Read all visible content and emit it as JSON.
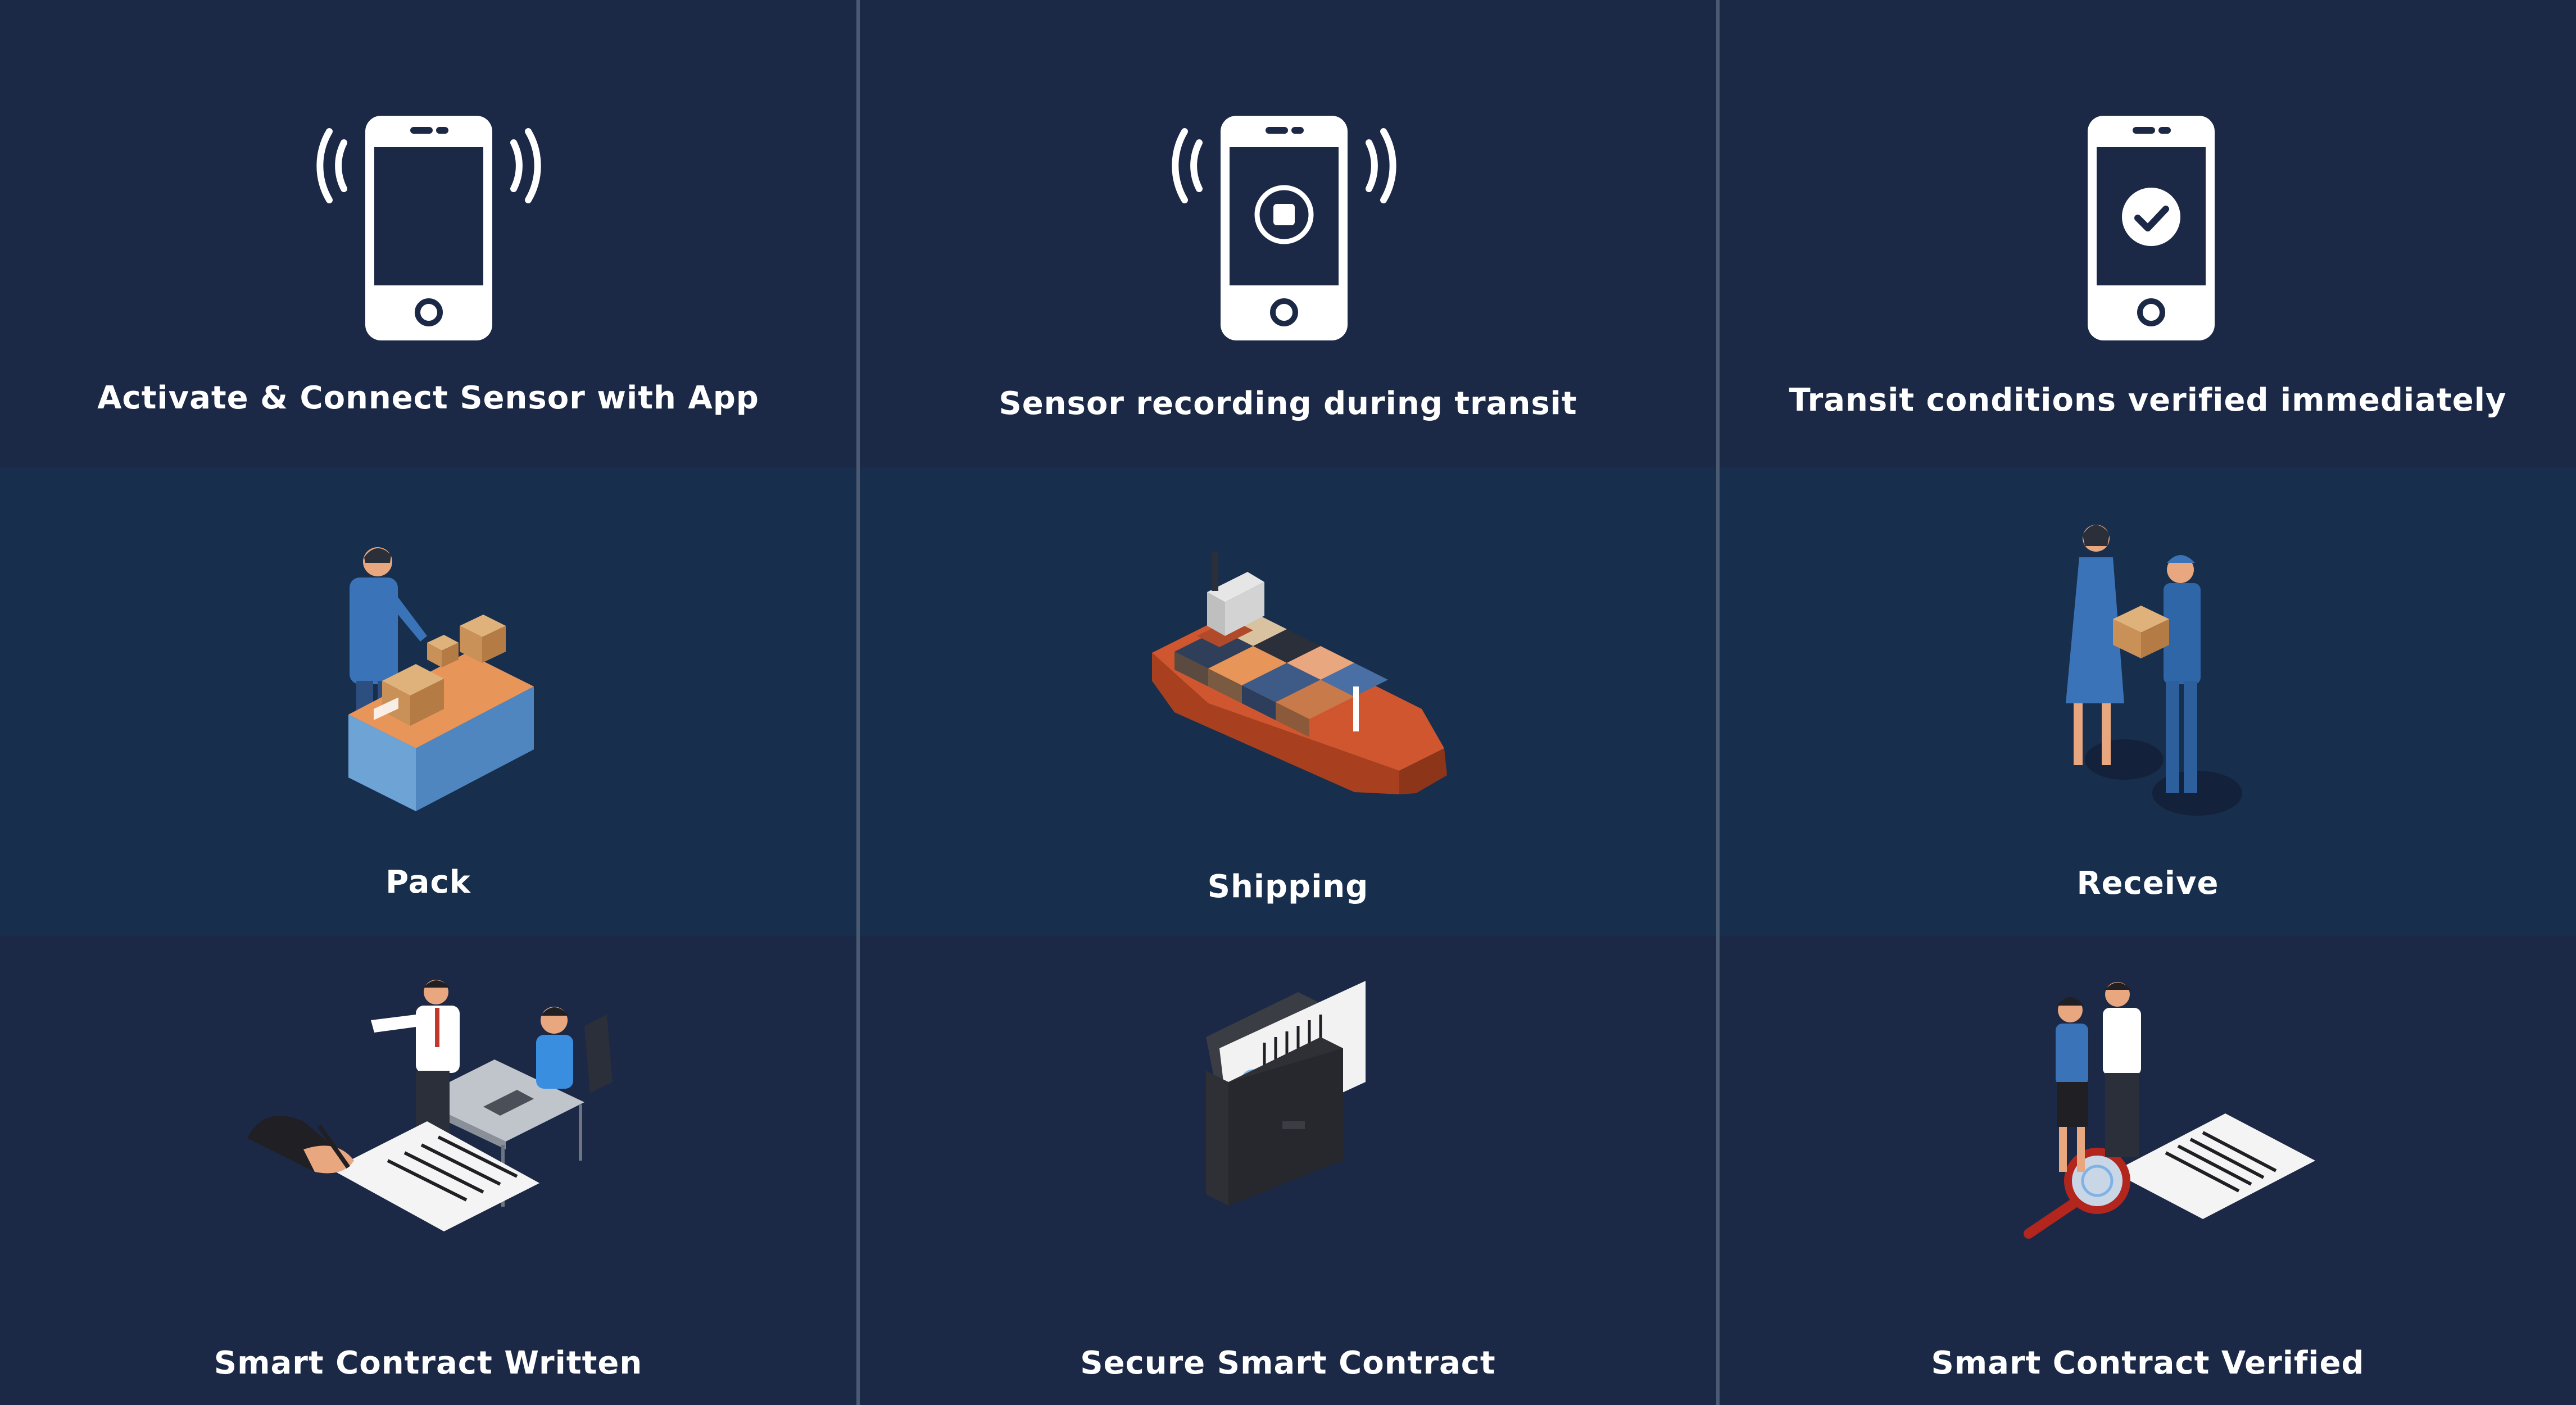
{
  "steps": [
    {
      "label": "Activate & Connect Sensor with App",
      "icon": "phone-signal-icon"
    },
    {
      "label": "Sensor recording during transit",
      "icon": "phone-recording-icon"
    },
    {
      "label": "Transit conditions verified immediately",
      "icon": "phone-check-icon"
    },
    {
      "label": "Pack",
      "icon": "packing-worker-illustration"
    },
    {
      "label": "Shipping",
      "icon": "container-ship-illustration"
    },
    {
      "label": "Receive",
      "icon": "delivery-handover-illustration"
    },
    {
      "label": "Smart Contract Written",
      "icon": "contract-signing-illustration"
    },
    {
      "label": "Secure Smart Contract",
      "icon": "secure-envelope-illustration"
    },
    {
      "label": "Smart Contract Verified",
      "icon": "contract-verification-illustration"
    }
  ],
  "colors": {
    "background": "#1b2946",
    "middle_band": "#172e4d",
    "divider": "#4a5a73",
    "text": "#ffffff"
  }
}
